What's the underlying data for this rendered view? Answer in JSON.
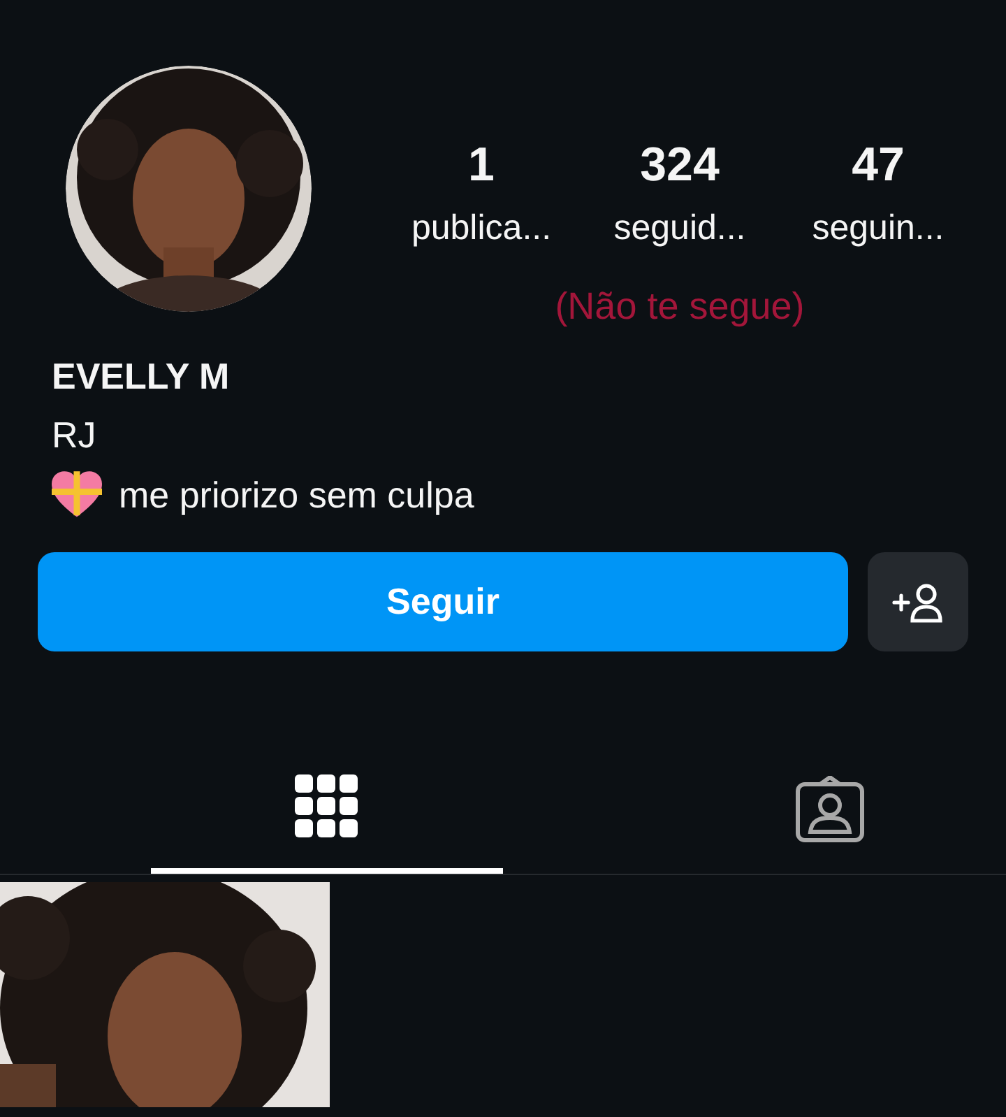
{
  "profile": {
    "stats": [
      {
        "value": "1",
        "label": "publica..."
      },
      {
        "value": "324",
        "label": "seguid..."
      },
      {
        "value": "47",
        "label": "seguin..."
      }
    ],
    "relation": "(Não te segue)",
    "name": "EVELLY M",
    "location": "RJ",
    "bio": "me priorizo sem culpa"
  },
  "actions": {
    "follow": "Seguir"
  },
  "tabs": [
    {
      "kind": "grid",
      "selected": true
    },
    {
      "kind": "tagged",
      "selected": false
    }
  ]
}
